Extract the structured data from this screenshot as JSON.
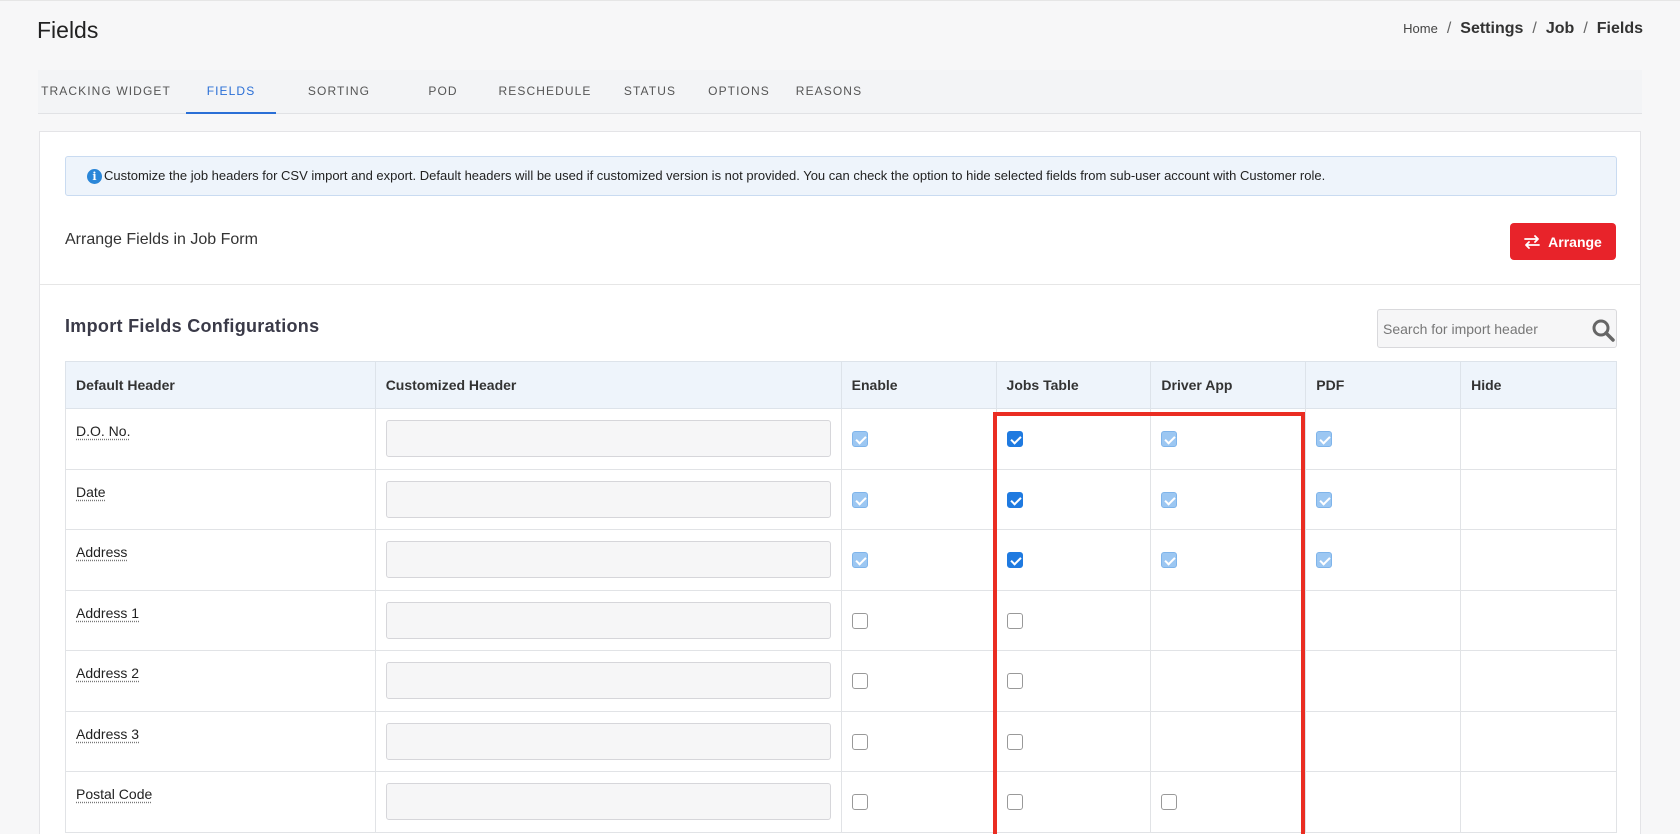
{
  "page": {
    "title": "Fields"
  },
  "breadcrumb": {
    "home": "Home",
    "items": [
      "Settings",
      "Job",
      "Fields"
    ]
  },
  "tabs": [
    {
      "label": "TRACKING WIDGET",
      "active": false
    },
    {
      "label": "FIELDS",
      "active": true
    },
    {
      "label": "SORTING",
      "active": false
    },
    {
      "label": "POD",
      "active": false
    },
    {
      "label": "RESCHEDULE",
      "active": false
    },
    {
      "label": "STATUS",
      "active": false
    },
    {
      "label": "OPTIONS",
      "active": false
    },
    {
      "label": "REASONS",
      "active": false
    }
  ],
  "info": {
    "icon": "info-icon",
    "text": "Customize the job headers for CSV import and export. Default headers will be used if customized version is not provided. You can check the option to hide selected fields from sub-user account with Customer role."
  },
  "arrange": {
    "label": "Arrange Fields in Job Form",
    "button_label": "Arrange",
    "button_icon": "swap-arrows-icon",
    "button_color": "#e8232a"
  },
  "import_section": {
    "title": "Import Fields Configurations",
    "search_placeholder": "Search for import header",
    "search_value": ""
  },
  "table": {
    "columns": [
      "Default Header",
      "Customized Header",
      "Enable",
      "Jobs Table",
      "Driver App",
      "PDF",
      "Hide"
    ],
    "rows": [
      {
        "default_header": "D.O. No.",
        "customized_header": "",
        "enable": "checked-disabled",
        "jobs_table": "checked",
        "driver_app": "checked-disabled",
        "pdf": "checked-disabled",
        "hide": ""
      },
      {
        "default_header": "Date",
        "customized_header": "",
        "enable": "checked-disabled",
        "jobs_table": "checked",
        "driver_app": "checked-disabled",
        "pdf": "checked-disabled",
        "hide": ""
      },
      {
        "default_header": "Address",
        "customized_header": "",
        "enable": "checked-disabled",
        "jobs_table": "checked",
        "driver_app": "checked-disabled",
        "pdf": "checked-disabled",
        "hide": ""
      },
      {
        "default_header": "Address 1",
        "customized_header": "",
        "enable": "unchecked",
        "jobs_table": "unchecked",
        "driver_app": "",
        "pdf": "",
        "hide": ""
      },
      {
        "default_header": "Address 2",
        "customized_header": "",
        "enable": "unchecked",
        "jobs_table": "unchecked",
        "driver_app": "",
        "pdf": "",
        "hide": ""
      },
      {
        "default_header": "Address 3",
        "customized_header": "",
        "enable": "unchecked",
        "jobs_table": "unchecked",
        "driver_app": "",
        "pdf": "",
        "hide": ""
      },
      {
        "default_header": "Postal Code",
        "customized_header": "",
        "enable": "unchecked",
        "jobs_table": "unchecked",
        "driver_app": "unchecked",
        "pdf": "",
        "hide": ""
      }
    ]
  },
  "colors": {
    "accent": "#2a6fd6",
    "checkbox_checked": "#1f7ae0",
    "highlight": "#ea2d22"
  }
}
